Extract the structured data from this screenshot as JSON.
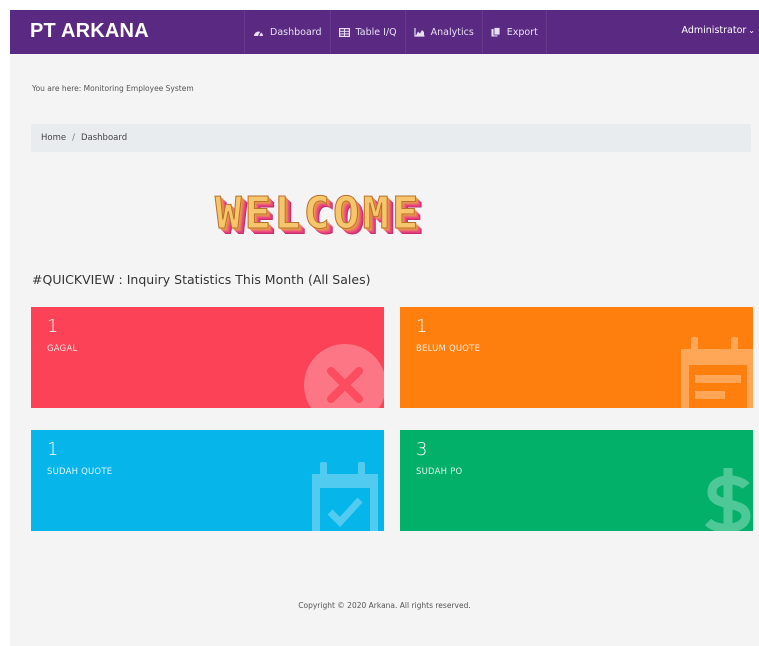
{
  "brand": "PT ARKANA",
  "nav": {
    "items": [
      {
        "label": "Dashboard",
        "icon": "dashboard-icon"
      },
      {
        "label": "Table I/Q",
        "icon": "table-icon"
      },
      {
        "label": "Analytics",
        "icon": "area-chart-icon"
      },
      {
        "label": "Export",
        "icon": "file-export-icon"
      }
    ],
    "user": "Administrator"
  },
  "location": {
    "prefix": "You are here:",
    "value": "Monitoring Employee System"
  },
  "breadcrumb": {
    "home": "Home",
    "separator": "/",
    "current": "Dashboard"
  },
  "welcome_text": "WELCOME",
  "section_title": "#QUICKVIEW : Inquiry Statistics This Month (All Sales)",
  "cards": [
    {
      "count": "1",
      "label": "GAGAL",
      "color": "#fc4256",
      "icon": "close-circle-icon"
    },
    {
      "count": "1",
      "label": "BELUM QUOTE",
      "color": "#ff7f0e",
      "icon": "calendar-list-icon"
    },
    {
      "count": "1",
      "label": "SUDAH QUOTE",
      "color": "#06b5ea",
      "icon": "calendar-check-icon"
    },
    {
      "count": "3",
      "label": "SUDAH PO",
      "color": "#03b06a",
      "icon": "dollar-icon"
    }
  ],
  "footer": {
    "copyright": "Copyright © 2020 Arkana. All rights reserved."
  }
}
